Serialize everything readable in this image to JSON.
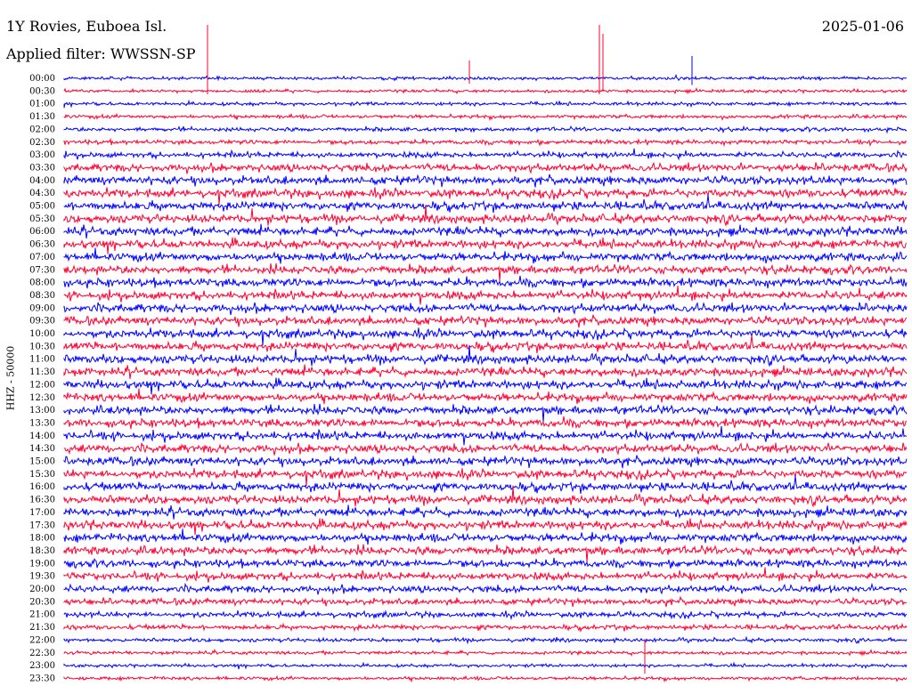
{
  "header": {
    "station": "1Y Rovies, Euboea Isl.",
    "date": "2025-01-06",
    "filter": "Applied filter: WWSSN-SP"
  },
  "side_label": "HHZ - 50000",
  "colors": {
    "odd": "#0000ff",
    "even": "#ff0033"
  },
  "chart_data": {
    "type": "line",
    "title": "1Y Rovies, Euboea Isl.",
    "subtitle": "Applied filter: WWSSN-SP",
    "date": "2025-01-06",
    "ylabel": "HHZ - 50000",
    "xlabel": "",
    "grid": false,
    "trace_colors": [
      "blue",
      "red"
    ],
    "traces": [
      {
        "label": "00:00",
        "amplitude": 0.25
      },
      {
        "label": "00:30",
        "amplitude": 0.25
      },
      {
        "label": "01:00",
        "amplitude": 0.3
      },
      {
        "label": "01:30",
        "amplitude": 0.35
      },
      {
        "label": "02:00",
        "amplitude": 0.4
      },
      {
        "label": "02:30",
        "amplitude": 0.45
      },
      {
        "label": "03:00",
        "amplitude": 0.6
      },
      {
        "label": "03:30",
        "amplitude": 0.9
      },
      {
        "label": "04:00",
        "amplitude": 1.0
      },
      {
        "label": "04:30",
        "amplitude": 1.0
      },
      {
        "label": "05:00",
        "amplitude": 1.0
      },
      {
        "label": "05:30",
        "amplitude": 1.0
      },
      {
        "label": "06:00",
        "amplitude": 1.0
      },
      {
        "label": "06:30",
        "amplitude": 1.0
      },
      {
        "label": "07:00",
        "amplitude": 1.0
      },
      {
        "label": "07:30",
        "amplitude": 1.0
      },
      {
        "label": "08:00",
        "amplitude": 1.0
      },
      {
        "label": "08:30",
        "amplitude": 1.0
      },
      {
        "label": "09:00",
        "amplitude": 1.0
      },
      {
        "label": "09:30",
        "amplitude": 1.0
      },
      {
        "label": "10:00",
        "amplitude": 1.0
      },
      {
        "label": "10:30",
        "amplitude": 1.0
      },
      {
        "label": "11:00",
        "amplitude": 1.0
      },
      {
        "label": "11:30",
        "amplitude": 1.0
      },
      {
        "label": "12:00",
        "amplitude": 1.0
      },
      {
        "label": "12:30",
        "amplitude": 1.0
      },
      {
        "label": "13:00",
        "amplitude": 1.0
      },
      {
        "label": "13:30",
        "amplitude": 1.0
      },
      {
        "label": "14:00",
        "amplitude": 1.0
      },
      {
        "label": "14:30",
        "amplitude": 1.0
      },
      {
        "label": "15:00",
        "amplitude": 1.0
      },
      {
        "label": "15:30",
        "amplitude": 1.0
      },
      {
        "label": "16:00",
        "amplitude": 1.0
      },
      {
        "label": "16:30",
        "amplitude": 1.0
      },
      {
        "label": "17:00",
        "amplitude": 1.0
      },
      {
        "label": "17:30",
        "amplitude": 1.0
      },
      {
        "label": "18:00",
        "amplitude": 1.0
      },
      {
        "label": "18:30",
        "amplitude": 1.0
      },
      {
        "label": "19:00",
        "amplitude": 0.9
      },
      {
        "label": "19:30",
        "amplitude": 0.9
      },
      {
        "label": "20:00",
        "amplitude": 0.8
      },
      {
        "label": "20:30",
        "amplitude": 0.7
      },
      {
        "label": "21:00",
        "amplitude": 0.6
      },
      {
        "label": "21:30",
        "amplitude": 0.5
      },
      {
        "label": "22:00",
        "amplitude": 0.35
      },
      {
        "label": "22:30",
        "amplitude": 0.3
      },
      {
        "label": "23:00",
        "amplitude": 0.25
      },
      {
        "label": "23:30",
        "amplitude": 0.3
      }
    ]
  }
}
